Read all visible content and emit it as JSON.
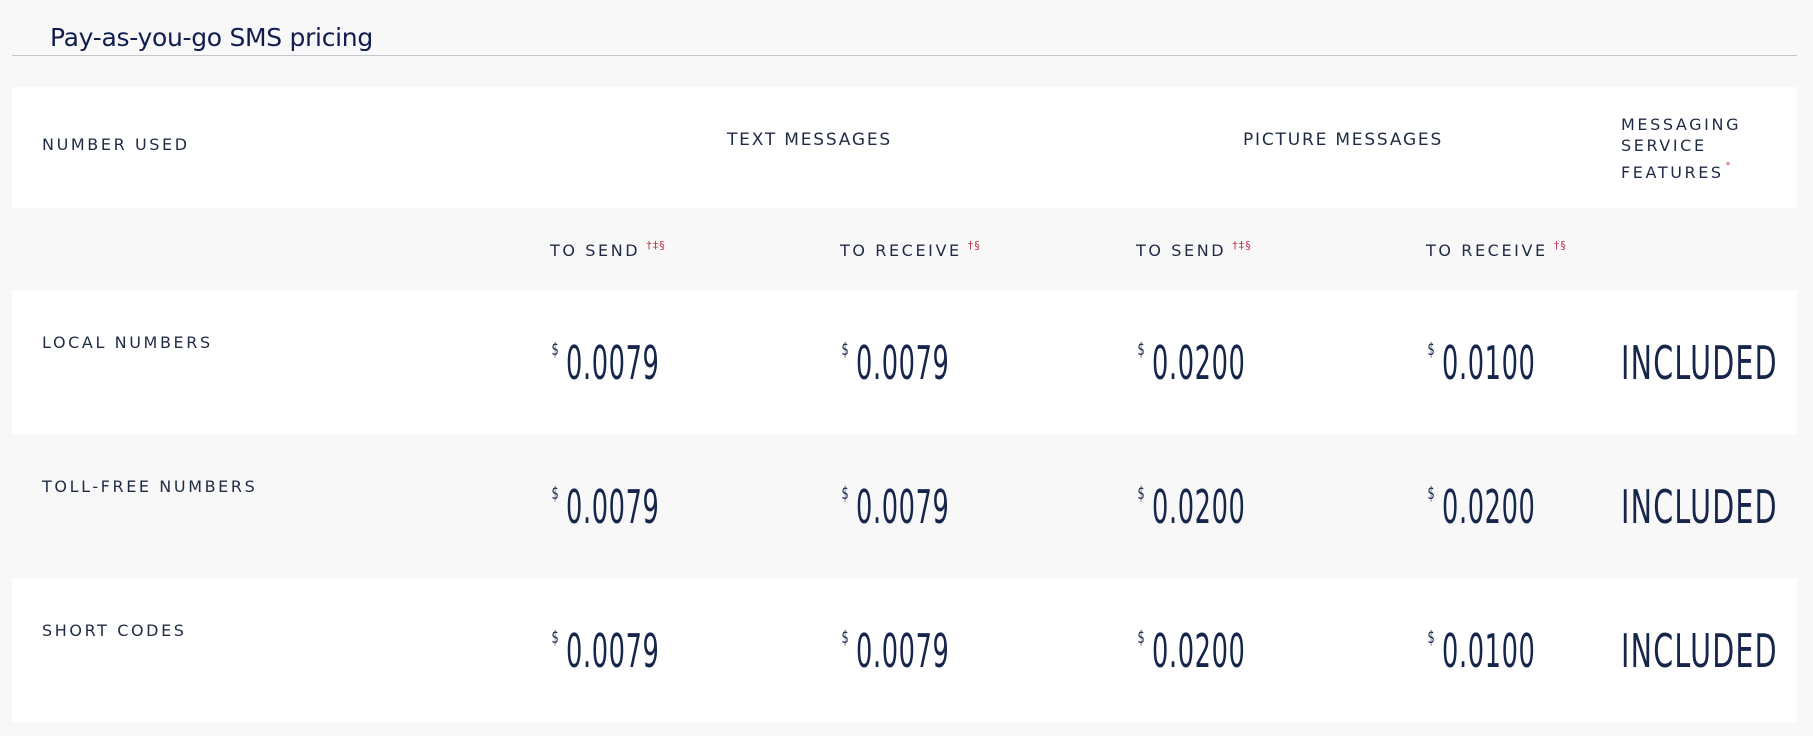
{
  "page_title": "Pay-as-you-go SMS pricing",
  "table": {
    "header": {
      "number_used": "NUMBER USED",
      "text_messages": "TEXT MESSAGES",
      "picture_messages": "PICTURE MESSAGES",
      "features": "MESSAGING SERVICE FEATURES",
      "features_footnote": "*"
    },
    "subheader": {
      "text_send": "TO SEND",
      "text_send_footnote": "†‡§",
      "text_receive": "TO RECEIVE",
      "text_receive_footnote": "†§",
      "pic_send": "TO SEND",
      "pic_send_footnote": "†‡§",
      "pic_receive": "TO RECEIVE",
      "pic_receive_footnote": "†§"
    },
    "currency_symbol": "$",
    "rows": [
      {
        "label": "LOCAL NUMBERS",
        "text_send": "0.0079",
        "text_receive": "0.0079",
        "pic_send": "0.0200",
        "pic_receive": "0.0100",
        "features": "INCLUDED"
      },
      {
        "label": "TOLL-FREE NUMBERS",
        "text_send": "0.0079",
        "text_receive": "0.0079",
        "pic_send": "0.0200",
        "pic_receive": "0.0200",
        "features": "INCLUDED"
      },
      {
        "label": "SHORT CODES",
        "text_send": "0.0079",
        "text_receive": "0.0079",
        "pic_send": "0.0200",
        "pic_receive": "0.0100",
        "features": "INCLUDED"
      }
    ]
  },
  "colors": {
    "text": "#1f2a44",
    "title": "#0f1c4d",
    "footnote": "#c0354a",
    "background": "#f8f8f9",
    "row_white": "#ffffff"
  }
}
